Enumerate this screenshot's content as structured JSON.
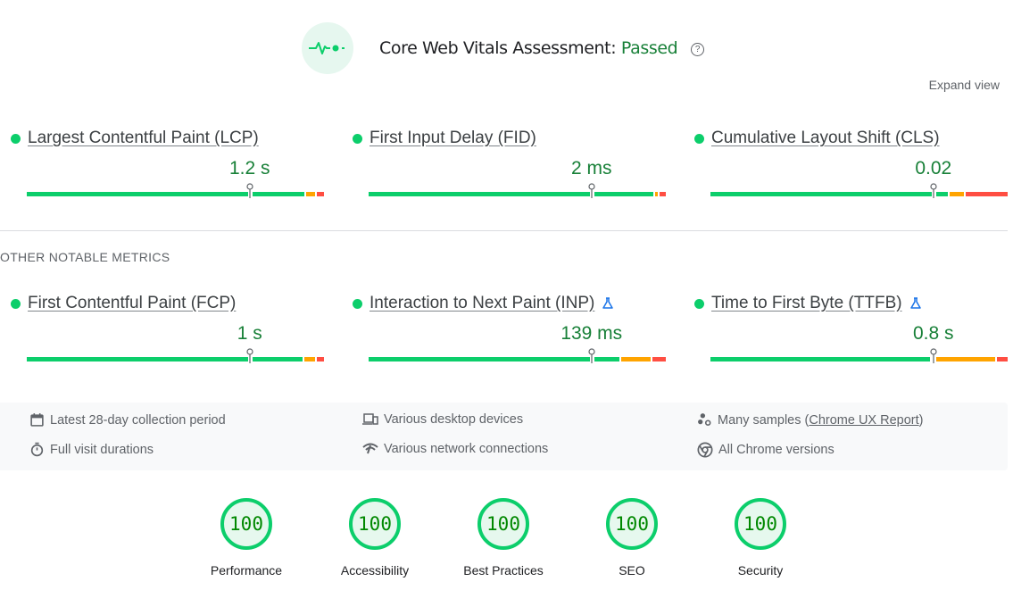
{
  "header": {
    "icon": "vitals-pulse-icon",
    "title": "Core Web Vitals Assessment:",
    "status": "Passed",
    "help_icon": "help-circle-icon"
  },
  "expand_label": "Expand view",
  "colors": {
    "good": "#0cce6b",
    "needs_improvement": "#ffa400",
    "poor": "#ff4e42",
    "pass_text": "#188038"
  },
  "core_metrics": [
    {
      "name": "Largest Contentful Paint (LCP)",
      "value": "1.2 s",
      "experimental": false,
      "distribution": {
        "good": 0.94,
        "needs_improvement": 0.035,
        "poor": 0.025
      },
      "p75_position": 0.75
    },
    {
      "name": "First Input Delay (FID)",
      "value": "2 ms",
      "experimental": false,
      "distribution": {
        "good": 0.965,
        "needs_improvement": 0.015,
        "poor": 0.02
      },
      "p75_position": 0.75
    },
    {
      "name": "Cumulative Layout Shift (CLS)",
      "value": "0.02",
      "experimental": false,
      "distribution": {
        "good": 0.805,
        "needs_improvement": 0.055,
        "poor": 0.14
      },
      "p75_position": 0.75
    }
  ],
  "other_section_label": "OTHER NOTABLE METRICS",
  "other_metrics": [
    {
      "name": "First Contentful Paint (FCP)",
      "value": "1 s",
      "experimental": false,
      "distribution": {
        "good": 0.935,
        "needs_improvement": 0.04,
        "poor": 0.025
      },
      "p75_position": 0.75
    },
    {
      "name": "Interaction to Next Paint (INP)",
      "value": "139 ms",
      "experimental": true,
      "distribution": {
        "good": 0.85,
        "needs_improvement": 0.105,
        "poor": 0.045
      },
      "p75_position": 0.75
    },
    {
      "name": "Time to First Byte (TTFB)",
      "value": "0.8 s",
      "experimental": true,
      "distribution": {
        "good": 0.745,
        "needs_improvement": 0.22,
        "poor": 0.035
      },
      "p75_position": 0.75
    }
  ],
  "info": {
    "collection_period": "Latest 28-day collection period",
    "visit_durations": "Full visit durations",
    "devices": "Various desktop devices",
    "network": "Various network connections",
    "samples_prefix": "Many samples (",
    "samples_link": "Chrome UX Report",
    "samples_suffix": ")",
    "chrome_versions": "All Chrome versions"
  },
  "scores": [
    {
      "label": "Performance",
      "value": "100"
    },
    {
      "label": "Accessibility",
      "value": "100"
    },
    {
      "label": "Best Practices",
      "value": "100"
    },
    {
      "label": "SEO",
      "value": "100"
    },
    {
      "label": "Security",
      "value": "100"
    }
  ]
}
